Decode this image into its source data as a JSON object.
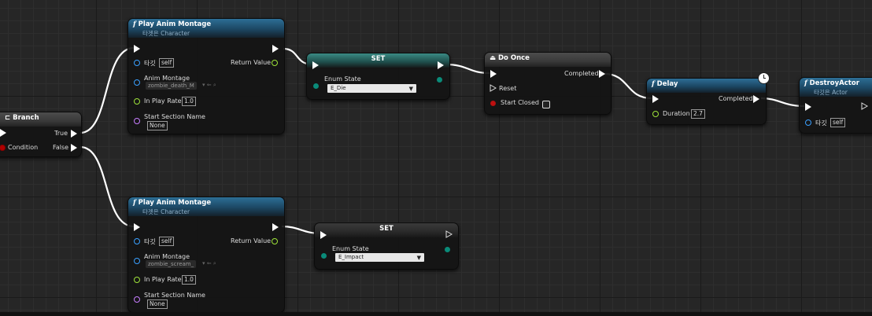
{
  "graph": {
    "branch": {
      "title": "Branch",
      "true_label": "True",
      "condition_label": "Condition",
      "false_label": "False"
    },
    "montage1": {
      "title": "Play Anim Montage",
      "subtitle": "타겟은 Character",
      "target_label": "타깃",
      "target_value": "self",
      "return_label": "Return Value",
      "montage_label": "Anim Montage",
      "montage_value": "zombie_death_M",
      "rate_label": "In Play Rate",
      "rate_value": "1.0",
      "section_label": "Start Section Name",
      "section_value": "None"
    },
    "montage2": {
      "title": "Play Anim Montage",
      "subtitle": "타겟은 Character",
      "target_label": "타깃",
      "target_value": "self",
      "return_label": "Return Value",
      "montage_label": "Anim Montage",
      "montage_value": "zombie_scream_",
      "rate_label": "In Play Rate",
      "rate_value": "1.0",
      "section_label": "Start Section Name",
      "section_value": "None"
    },
    "set1": {
      "title": "SET",
      "enum_label": "Enum State",
      "enum_value": "E_Die"
    },
    "set2": {
      "title": "SET",
      "enum_label": "Enum State",
      "enum_value": "E_Impact"
    },
    "do_once": {
      "title": "Do Once",
      "completed_label": "Completed",
      "reset_label": "Reset",
      "start_closed_label": "Start Closed"
    },
    "delay": {
      "title": "Delay",
      "completed_label": "Completed",
      "duration_label": "Duration",
      "duration_value": "2.7"
    },
    "destroy": {
      "title": "DestroyActor",
      "subtitle": "타깃은 Actor",
      "target_label": "타깃",
      "target_value": "self"
    }
  },
  "icons": {
    "function": "f",
    "do_once": "do-once-icon",
    "branch": "branch-icon",
    "latent": "clock-icon"
  },
  "colors": {
    "exec_wire": "#ffffff",
    "header_function": "#2d6e96",
    "header_macro": "#3a3a3a",
    "enum_pin": "#0a8b79",
    "float_pin": "#9ee33a",
    "object_pin": "#3aa0ff",
    "bool_pin": "#b00000",
    "name_pin": "#c77dff"
  }
}
